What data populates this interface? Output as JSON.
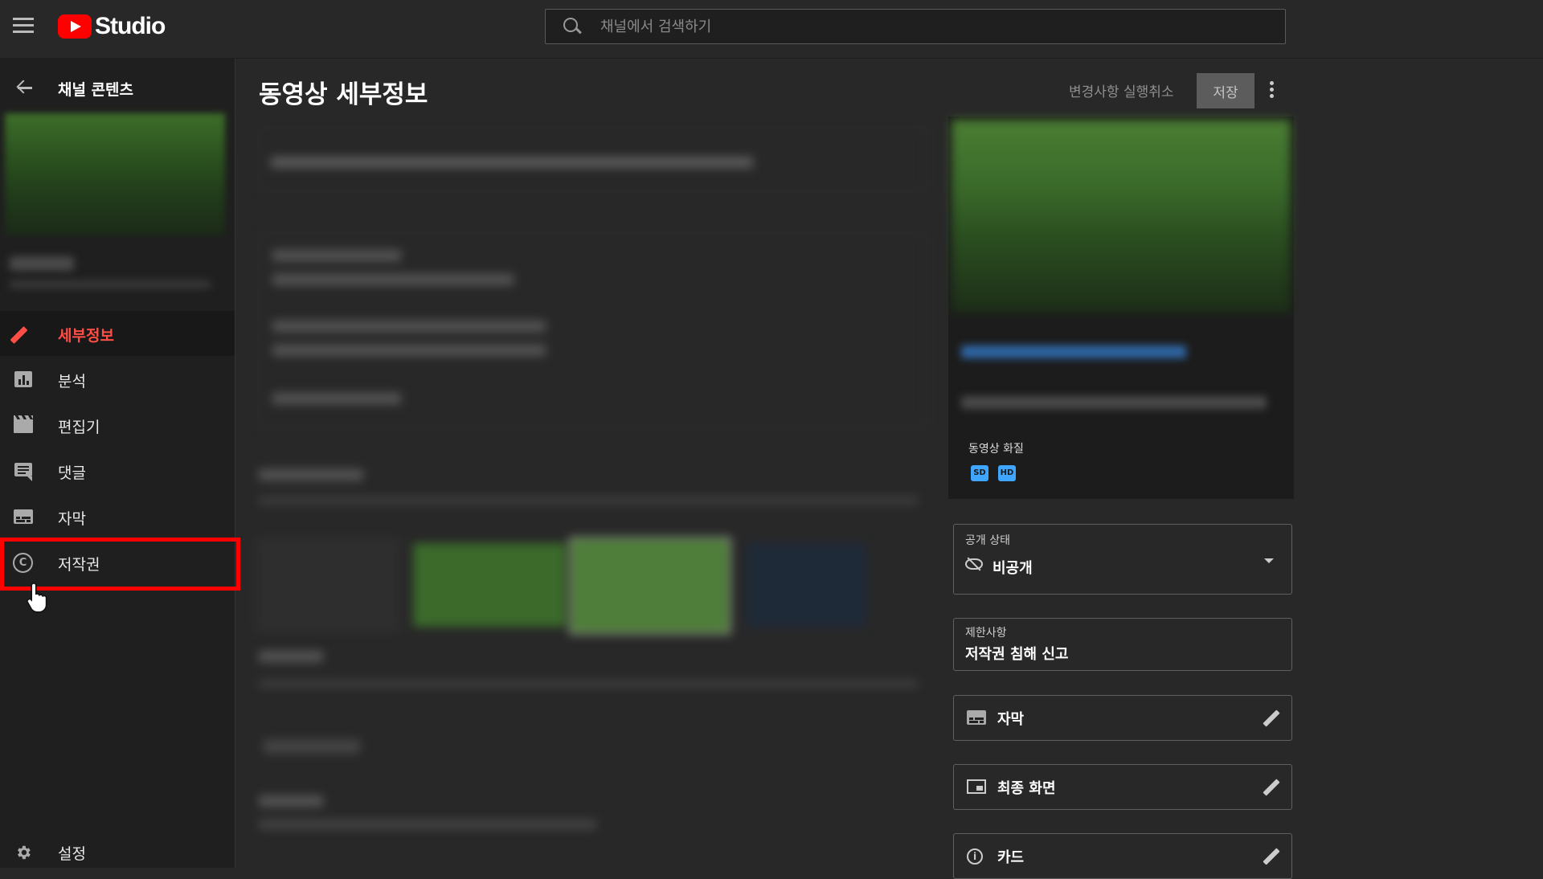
{
  "header": {
    "brand": "Studio",
    "search_placeholder": "채널에서 검색하기"
  },
  "sidebar": {
    "back_title": "채널 콘텐츠",
    "items": [
      {
        "label": "세부정보",
        "icon": "pencil-icon",
        "active": true
      },
      {
        "label": "분석",
        "icon": "analytics-icon",
        "active": false
      },
      {
        "label": "편집기",
        "icon": "clapperboard-icon",
        "active": false
      },
      {
        "label": "댓글",
        "icon": "comment-icon",
        "active": false
      },
      {
        "label": "자막",
        "icon": "subtitles-icon",
        "active": false
      },
      {
        "label": "저작권",
        "icon": "copyright-icon",
        "active": false
      }
    ],
    "settings_label": "설정"
  },
  "main": {
    "title": "동영상 세부정보",
    "undo_label": "변경사항 실행취소",
    "save_label": "저장"
  },
  "right_panel": {
    "quality_label": "동영상 화질",
    "badges": [
      "SD",
      "HD"
    ],
    "visibility": {
      "label": "공개 상태",
      "value": "비공개"
    },
    "restrictions": {
      "label": "제한사항",
      "value": "저작권 침해 신고"
    },
    "subtitles_label": "자막",
    "end_screen_label": "최종 화면",
    "cards_label": "카드"
  },
  "colors": {
    "accent_red": "#ff4e45",
    "highlight": "#ff0000",
    "badge_blue": "#3ea6ff"
  }
}
